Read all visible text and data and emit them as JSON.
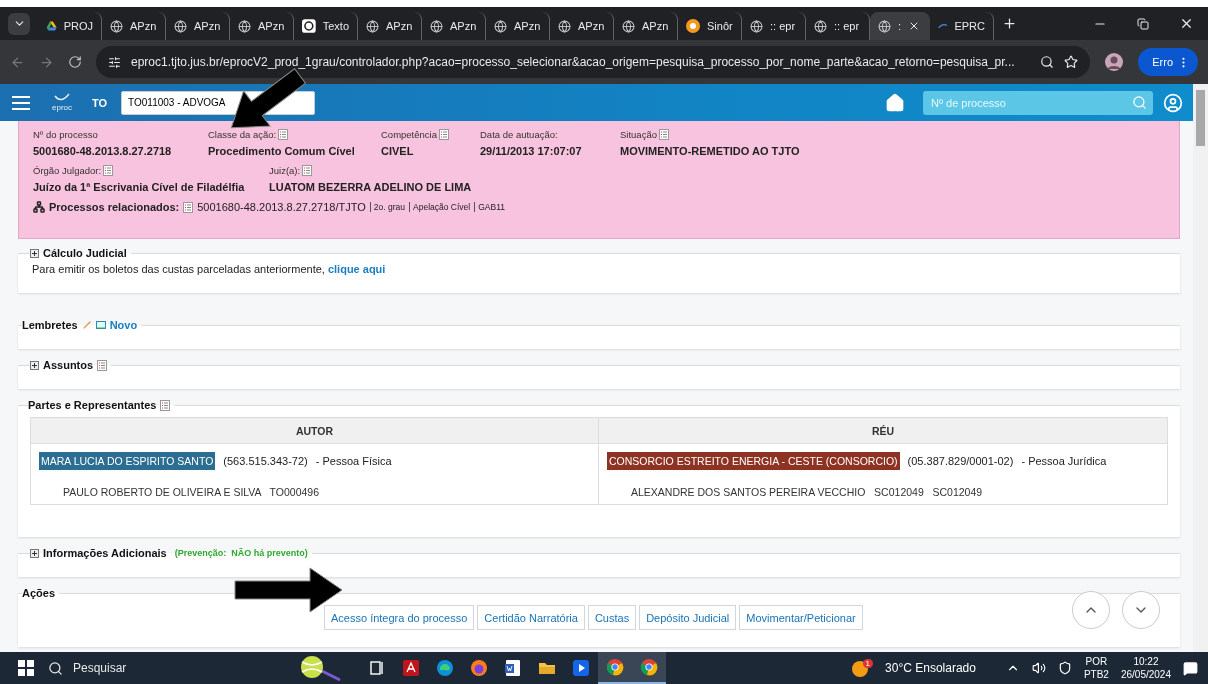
{
  "browser": {
    "tabs": [
      {
        "kind": "drive",
        "label": "PROJ",
        "selected": false
      },
      {
        "kind": "globe",
        "label": "APzn",
        "selected": false
      },
      {
        "kind": "globe",
        "label": "APzn",
        "selected": false
      },
      {
        "kind": "globe",
        "label": "APzn",
        "selected": false
      },
      {
        "kind": "chat",
        "label": "Texto",
        "selected": false
      },
      {
        "kind": "globe",
        "label": "APzn",
        "selected": false
      },
      {
        "kind": "globe",
        "label": "APzn",
        "selected": false
      },
      {
        "kind": "globe",
        "label": "APzn",
        "selected": false
      },
      {
        "kind": "globe",
        "label": "APzn",
        "selected": false
      },
      {
        "kind": "globe",
        "label": "APzn",
        "selected": false
      },
      {
        "kind": "orange",
        "label": "Sinôr",
        "selected": false
      },
      {
        "kind": "globe",
        "label": ":: epr",
        "selected": false
      },
      {
        "kind": "globe",
        "label": ":: epr",
        "selected": false
      },
      {
        "kind": "globe",
        "label": ":",
        "selected": true
      },
      {
        "kind": "eproc",
        "label": "EPRC",
        "selected": false
      }
    ],
    "url": "eproc1.tjto.jus.br/eprocV2_prod_1grau/controlador.php?acao=processo_selecionar&acao_origem=pesquisa_processo_por_nome_parte&acao_retorno=pesquisa_pr...",
    "profile": "Erro"
  },
  "app": {
    "logo": "eproc",
    "state": "TO",
    "user_field": "TO011003 - ADVOGA",
    "search": {
      "placeholder": "Nº de processo"
    }
  },
  "process": {
    "rows": [
      [
        {
          "label": "Nº do processo",
          "value": "5001680-48.2013.8.27.2718",
          "info": false
        },
        {
          "label": "Classe da ação:",
          "value": "Procedimento Comum Cível",
          "info": true
        },
        {
          "label": "Competência",
          "value": "CIVEL",
          "info": true
        },
        {
          "label": "Data de autuação:",
          "value": "29/11/2013 17:07:07",
          "info": false
        },
        {
          "label": "Situação",
          "value": "MOVIMENTO-REMETIDO AO TJTO",
          "info": true
        }
      ],
      [
        {
          "label": "Órgão Julgador:",
          "value": "Juízo da 1ª Escrivania Cível de Filadélfia",
          "info": true
        },
        {
          "label": "Juiz(a):",
          "value": "LUATOM BEZERRA ADELINO DE LIMA",
          "info": true
        }
      ]
    ],
    "related": {
      "label": "Processos relacionados:",
      "number": "5001680-48.2013.8.27.2718/TJTO",
      "details": [
        "2o. grau",
        "Apelação Cível",
        "GAB11"
      ]
    }
  },
  "calculo": {
    "title": "Cálculo Judicial",
    "expanded": false,
    "text": "Para emitir os boletos das custas parceladas anteriormente,",
    "link": "clique aqui"
  },
  "lembretes": {
    "title": "Lembretes",
    "link": "Novo"
  },
  "assuntos": {
    "title": "Assuntos",
    "expanded": false
  },
  "partes": {
    "title": "Partes e Representantes",
    "columns": [
      {
        "heading": "AUTOR",
        "party": {
          "name": "MARA LUCIA DO ESPIRITO SANTO",
          "color": "#2c6e92",
          "doc": "(563.515.343-72)",
          "type": "- Pessoa Física"
        },
        "representative": "PAULO ROBERTO DE OLIVEIRA E SILVA   TO000496"
      },
      {
        "heading": "RÉU",
        "party": {
          "name": "CONSORCIO ESTREITO ENERGIA - CESTE (CONSORCIO)",
          "color": "#8e3324",
          "doc": "(05.387.829/0001-02)",
          "type": "- Pessoa Jurídica"
        },
        "representative": "ALEXANDRE DOS SANTOS PEREIRA VECCHIO   SC012049   SC012049"
      }
    ]
  },
  "info": {
    "title": "Informações Adicionais",
    "expanded": false,
    "note": "(Prevenção:  NÃO há prevento)"
  },
  "acoes": {
    "title": "Ações",
    "buttons": [
      "Acesso íntegra do processo",
      "Certidão Narratória",
      "Custas",
      "Depósito Judicial",
      "Movimentar/Peticionar"
    ]
  },
  "taskbar": {
    "search": "Pesquisar",
    "apps": [
      {
        "kind": "taskview",
        "selected": false
      },
      {
        "kind": "acrobat",
        "selected": false
      },
      {
        "kind": "edge",
        "selected": false
      },
      {
        "kind": "firefox",
        "selected": false
      },
      {
        "kind": "word",
        "selected": false
      },
      {
        "kind": "folder",
        "selected": false
      },
      {
        "kind": "player",
        "selected": false
      },
      {
        "kind": "chrome",
        "selected": true
      },
      {
        "kind": "chrome",
        "selected": true
      }
    ],
    "weather_badge": "1",
    "weather": "30°C Ensolarado",
    "language": [
      "POR",
      "PTB2"
    ],
    "time": "10:22",
    "date": "26/05/2024"
  }
}
